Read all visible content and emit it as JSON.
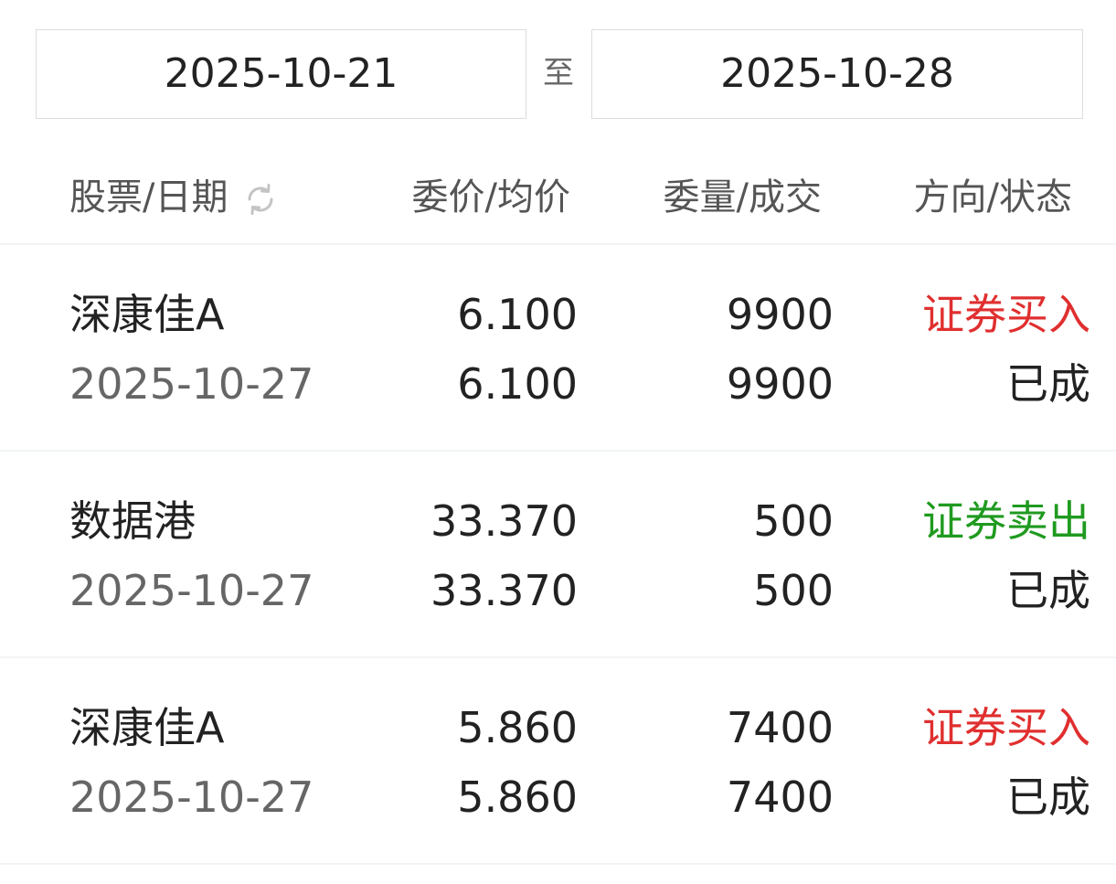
{
  "date_range": {
    "start": "2025-10-21",
    "separator": "至",
    "end": "2025-10-28"
  },
  "header": {
    "stock_date": "股票/日期",
    "price": "委价/均价",
    "quantity": "委量/成交",
    "direction_status": "方向/状态"
  },
  "icons": {
    "refresh": "refresh-icon"
  },
  "colors": {
    "buy": "#e02f2f",
    "sell": "#1f9a1f"
  },
  "orders": [
    {
      "name": "深康佳A",
      "date": "2025-10-27",
      "order_price": "6.100",
      "avg_price": "6.100",
      "order_qty": "9900",
      "filled_qty": "9900",
      "direction": "证券买入",
      "direction_type": "buy",
      "status": "已成"
    },
    {
      "name": "数据港",
      "date": "2025-10-27",
      "order_price": "33.370",
      "avg_price": "33.370",
      "order_qty": "500",
      "filled_qty": "500",
      "direction": "证券卖出",
      "direction_type": "sell",
      "status": "已成"
    },
    {
      "name": "深康佳A",
      "date": "2025-10-27",
      "order_price": "5.860",
      "avg_price": "5.860",
      "order_qty": "7400",
      "filled_qty": "7400",
      "direction": "证券买入",
      "direction_type": "buy",
      "status": "已成"
    }
  ]
}
